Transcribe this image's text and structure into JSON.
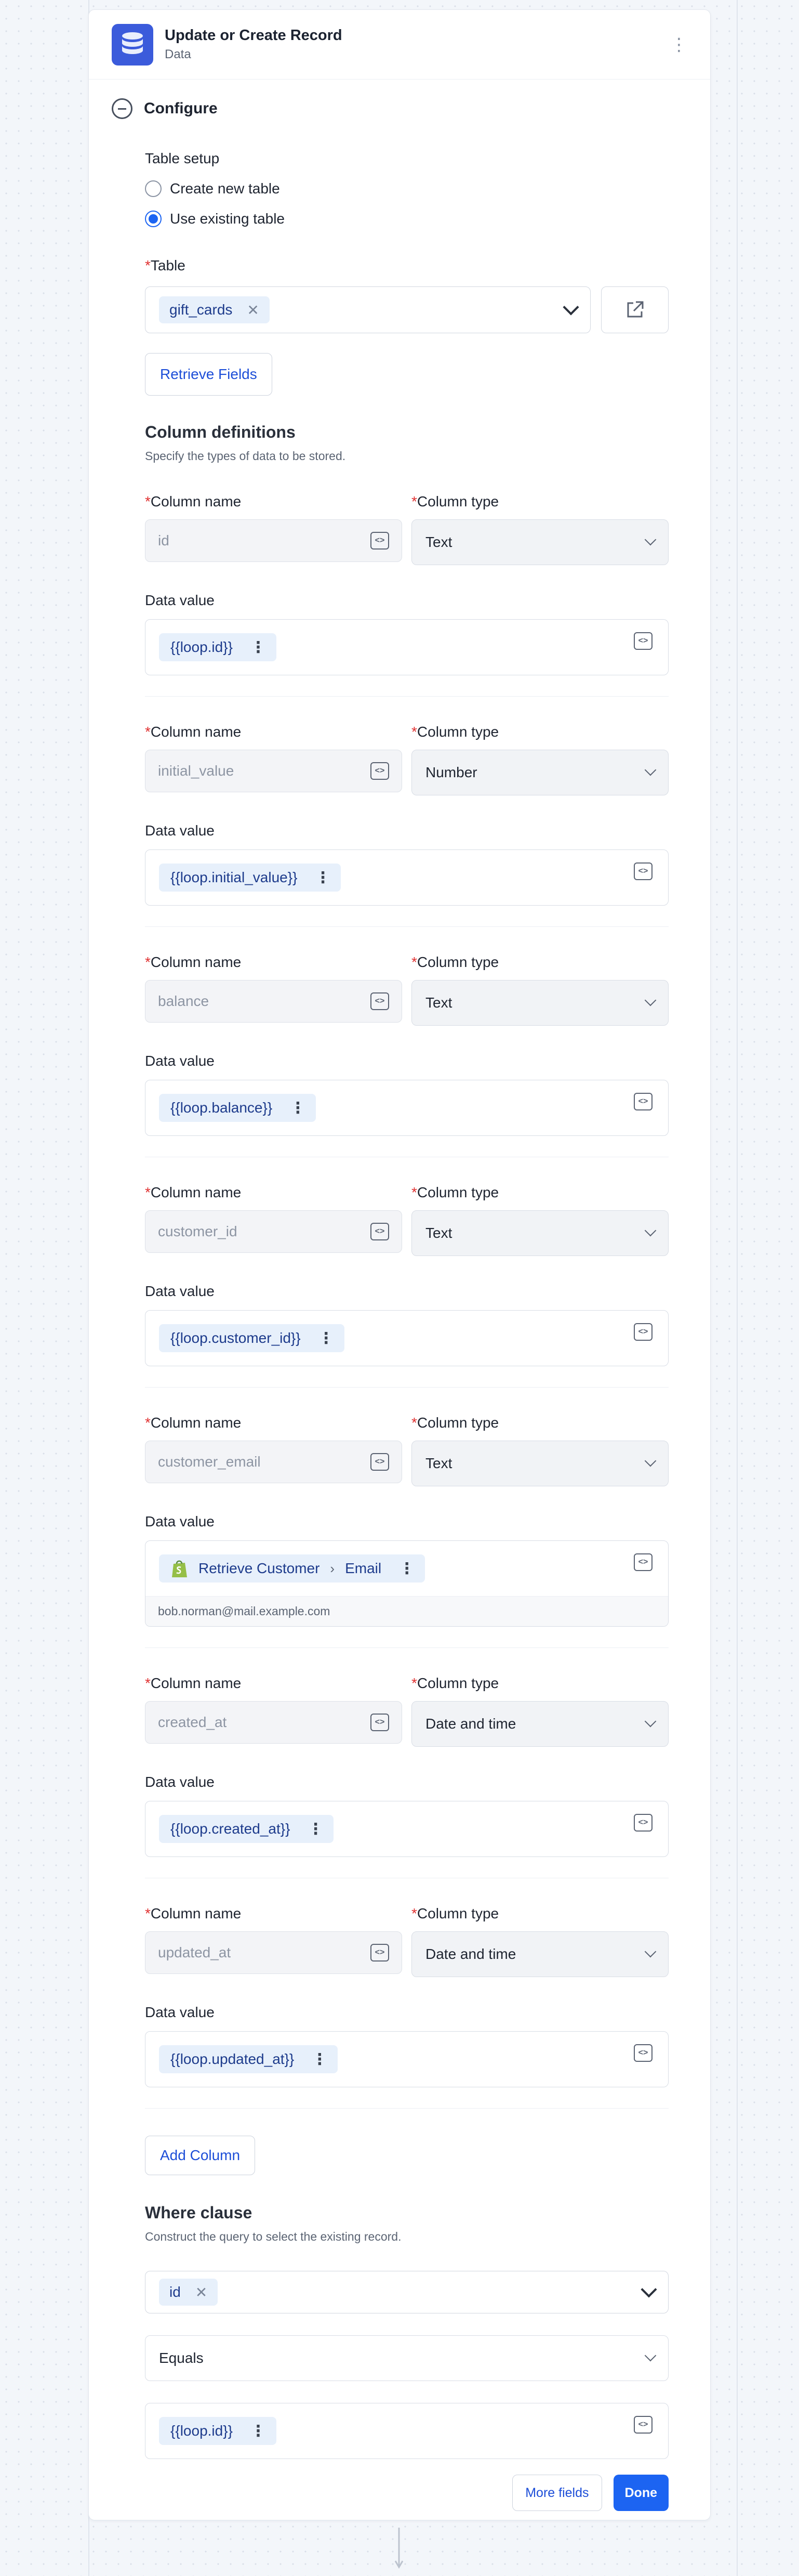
{
  "step": {
    "title": "Update or Create Record",
    "subtitle": "Data",
    "configure_label": "Configure"
  },
  "table_setup": {
    "label": "Table setup",
    "options": [
      {
        "label": "Create new table",
        "selected": false
      },
      {
        "label": "Use existing table",
        "selected": true
      }
    ]
  },
  "table": {
    "label": "Table",
    "value": "gift_cards"
  },
  "retrieve_fields_label": "Retrieve Fields",
  "column_definitions": {
    "title": "Column definitions",
    "subtitle": "Specify the types of data to be stored.",
    "column_name_label": "Column name",
    "column_type_label": "Column type",
    "data_value_label": "Data value",
    "columns": [
      {
        "name": "id",
        "type": "Text",
        "value": "{{loop.id}}"
      },
      {
        "name": "initial_value",
        "type": "Number",
        "value": "{{loop.initial_value}}"
      },
      {
        "name": "balance",
        "type": "Text",
        "value": "{{loop.balance}}"
      },
      {
        "name": "customer_id",
        "type": "Text",
        "value": "{{loop.customer_id}}"
      },
      {
        "name": "customer_email",
        "type": "Text",
        "value_crumb": [
          "Retrieve Customer",
          "Email"
        ],
        "preview": "bob.norman@mail.example.com"
      },
      {
        "name": "created_at",
        "type": "Date and time",
        "value": "{{loop.created_at}}"
      },
      {
        "name": "updated_at",
        "type": "Date and time",
        "value": "{{loop.updated_at}}"
      }
    ]
  },
  "add_column_label": "Add Column",
  "where_clause": {
    "title": "Where clause",
    "subtitle": "Construct the query to select the existing record.",
    "field": "id",
    "operator": "Equals",
    "value": "{{loop.id}}"
  },
  "footer": {
    "more_fields": "More fields",
    "done": "Done"
  },
  "colors": {
    "accent": "#1c64f2",
    "chip_bg": "#e7f0fb",
    "app_icon": "#3b5bdb",
    "required": "#e03131"
  }
}
